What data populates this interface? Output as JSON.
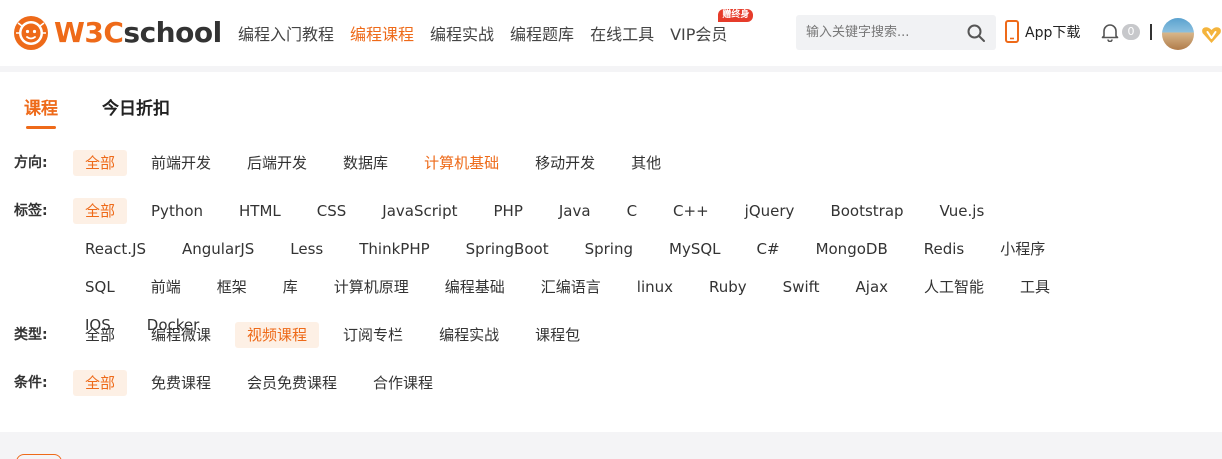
{
  "header": {
    "logo": {
      "w3c": "W3C",
      "school": "school"
    },
    "nav": [
      {
        "label": "编程入门教程",
        "active": false
      },
      {
        "label": "编程课程",
        "active": true
      },
      {
        "label": "编程实战",
        "active": false
      },
      {
        "label": "编程题库",
        "active": false
      },
      {
        "label": "在线工具",
        "active": false
      },
      {
        "label": "VIP会员",
        "active": false,
        "badge": "赠终身"
      }
    ],
    "search": {
      "placeholder": "输入关键字搜索..."
    },
    "app_download": "App下载",
    "notifications": "0"
  },
  "tabs": [
    {
      "label": "课程",
      "active": true
    },
    {
      "label": "今日折扣",
      "active": false
    }
  ],
  "filters": [
    {
      "label": "方向:",
      "options": [
        "全部",
        "前端开发",
        "后端开发",
        "数据库",
        "计算机基础",
        "移动开发",
        "其他"
      ],
      "selected": 0,
      "highlighted": 4
    },
    {
      "label": "标签:",
      "options": [
        "全部",
        "Python",
        "HTML",
        "CSS",
        "JavaScript",
        "PHP",
        "Java",
        "C",
        "C++",
        "jQuery",
        "Bootstrap",
        "Vue.js",
        "React.JS",
        "AngularJS",
        "Less",
        "ThinkPHP",
        "SpringBoot",
        "Spring",
        "MySQL",
        "C#",
        "MongoDB",
        "Redis",
        "小程序",
        "SQL",
        "前端",
        "框架",
        "库",
        "计算机原理",
        "编程基础",
        "汇编语言",
        "linux",
        "Ruby",
        "Swift",
        "Ajax",
        "人工智能",
        "工具",
        "IOS",
        "Docker"
      ],
      "selected": 0,
      "highlighted": -1
    },
    {
      "label": "类型:",
      "options": [
        "全部",
        "编程微课",
        "视频课程",
        "订阅专栏",
        "编程实战",
        "课程包"
      ],
      "selected": 2,
      "highlighted": -1
    },
    {
      "label": "条件:",
      "options": [
        "全部",
        "免费课程",
        "会员免费课程",
        "合作课程"
      ],
      "selected": 0,
      "highlighted": -1
    }
  ],
  "colors": {
    "accent": "#ee6a19",
    "chip_bg": "#fdf0e5",
    "badge": "#e63c2b"
  }
}
